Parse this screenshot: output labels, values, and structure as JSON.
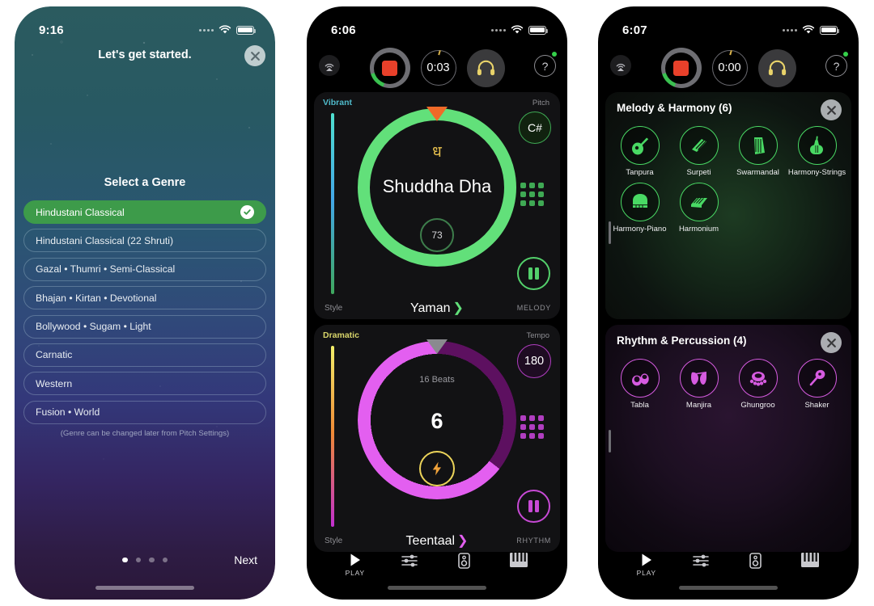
{
  "phone1": {
    "status": {
      "time": "9:16"
    },
    "header_title": "Let's get started.",
    "close_label": "×",
    "section_title": "Select a Genre",
    "genres": [
      {
        "label": "Hindustani Classical",
        "selected": true
      },
      {
        "label": "Hindustani Classical (22 Shruti)",
        "selected": false
      },
      {
        "label": "Gazal • Thumri • Semi-Classical",
        "selected": false
      },
      {
        "label": "Bhajan • Kirtan • Devotional",
        "selected": false
      },
      {
        "label": "Bollywood • Sugam • Light",
        "selected": false
      },
      {
        "label": "Carnatic",
        "selected": false
      },
      {
        "label": "Western",
        "selected": false
      },
      {
        "label": "Fusion • World",
        "selected": false
      }
    ],
    "note": "(Genre can be changed later from Pitch Settings)",
    "next_label": "Next",
    "page_dots": 4,
    "active_dot": 1
  },
  "phone2": {
    "status": {
      "time": "6:06"
    },
    "toolbar": {
      "timer": "0:03"
    },
    "melody_card": {
      "style_top_label": "Vibrant",
      "style_bottom_label": "Style",
      "pitch_label": "Pitch",
      "pitch_value": "C#",
      "swara_glyph": "ध",
      "note_name": "Shuddha Dha",
      "gauge_value": "73",
      "raga_name": "Yaman",
      "chevron": "❯",
      "section_label": "MELODY"
    },
    "rhythm_card": {
      "style_top_label": "Dramatic",
      "style_bottom_label": "Style",
      "tempo_label": "Tempo",
      "tempo_value": "180",
      "beats_label": "16 Beats",
      "beat_number": "6",
      "taal_name": "Teentaal",
      "chevron": "❯",
      "section_label": "RHYTHM"
    },
    "tabs": [
      {
        "label": "PLAY",
        "icon": "play-icon"
      },
      {
        "label": "",
        "icon": "sliders-icon"
      },
      {
        "label": "",
        "icon": "speaker-icon"
      },
      {
        "label": "",
        "icon": "piano-icon"
      }
    ]
  },
  "phone3": {
    "status": {
      "time": "6:07"
    },
    "toolbar": {
      "timer": "0:00"
    },
    "melody_panel": {
      "title": "Melody & Harmony (6)",
      "instruments": [
        {
          "name": "Tanpura",
          "icon": "tanpura-icon"
        },
        {
          "name": "Surpeti",
          "icon": "surpeti-icon"
        },
        {
          "name": "Swarmandal",
          "icon": "swarmandal-icon"
        },
        {
          "name": "Harmony-Strings",
          "icon": "harmony-strings-icon"
        },
        {
          "name": "Harmony-Piano",
          "icon": "harmony-piano-icon"
        },
        {
          "name": "Harmonium",
          "icon": "harmonium-icon"
        }
      ]
    },
    "rhythm_panel": {
      "title": "Rhythm & Percussion (4)",
      "instruments": [
        {
          "name": "Tabla",
          "icon": "tabla-icon"
        },
        {
          "name": "Manjira",
          "icon": "manjira-icon"
        },
        {
          "name": "Ghungroo",
          "icon": "ghungroo-icon"
        },
        {
          "name": "Shaker",
          "icon": "shaker-icon"
        }
      ]
    },
    "tabs": [
      {
        "label": "PLAY",
        "icon": "play-icon"
      },
      {
        "label": "",
        "icon": "sliders-icon"
      },
      {
        "label": "",
        "icon": "speaker-icon"
      },
      {
        "label": "",
        "icon": "piano-icon"
      }
    ]
  },
  "colors": {
    "melody_green": "#62e07a",
    "rhythm_pink": "#e35ff0",
    "selected_green": "#3d9b4a",
    "record_red": "#e8402a",
    "accent_gold": "#e7c04e"
  }
}
